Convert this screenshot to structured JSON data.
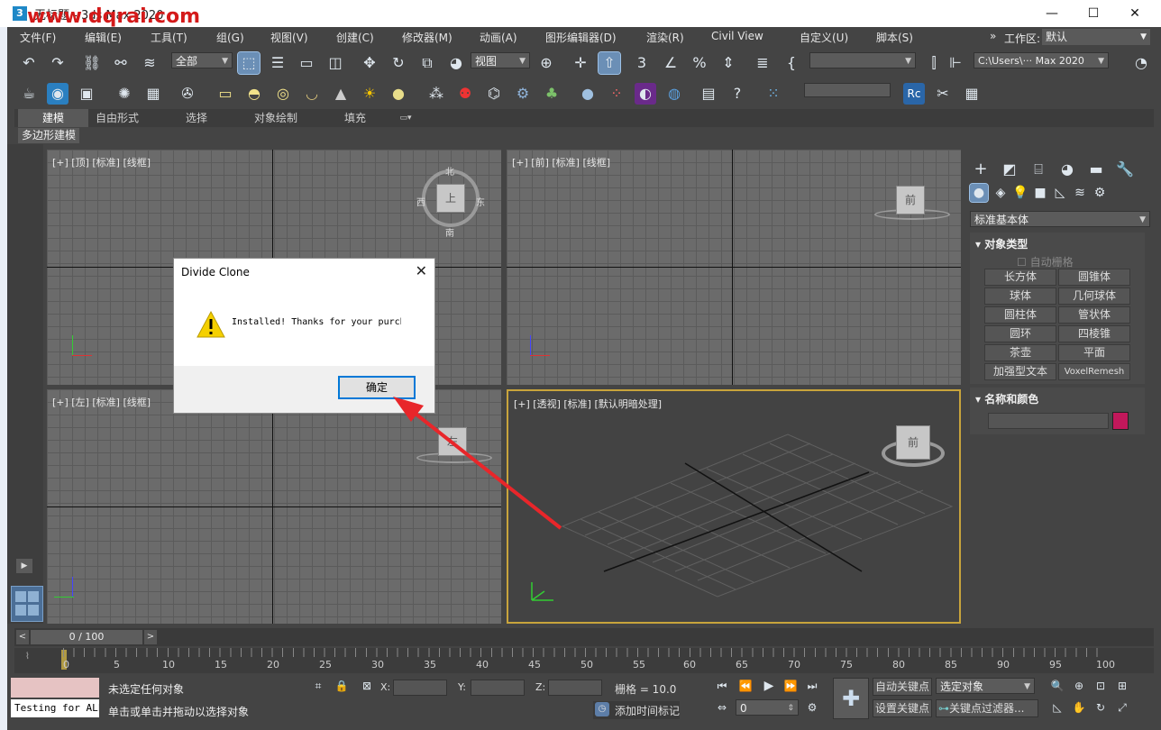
{
  "window": {
    "title": "无标题 - 3ds Max 2020",
    "watermark": "www.dqrai.com",
    "controls": {
      "minimize": "—",
      "maximize": "☐",
      "close": "✕"
    }
  },
  "menubar": {
    "items": [
      "文件(F)",
      "编辑(E)",
      "工具(T)",
      "组(G)",
      "视图(V)",
      "创建(C)",
      "修改器(M)",
      "动画(A)",
      "图形编辑器(D)",
      "渲染(R)",
      "Civil View",
      "自定义(U)",
      "脚本(S)"
    ],
    "workspace_label": "工作区:",
    "workspace_value": "默认",
    "overflow": "»"
  },
  "toolbar": {
    "selection_filter": "全部",
    "ref_coord": "视图",
    "named_sel": "",
    "path": "C:\\Users\\··· Max 2020"
  },
  "ribbon": {
    "tabs": [
      "建模",
      "自由形式",
      "选择",
      "对象绘制",
      "填充"
    ],
    "sub_label": "多边形建模"
  },
  "viewports": {
    "top": {
      "label": "[+] [顶] [标准] [线框]",
      "cube": "上",
      "compass": [
        "北",
        "东",
        "南",
        "西"
      ]
    },
    "front": {
      "label": "[+] [前] [标准] [线框]",
      "cube": "前"
    },
    "left": {
      "label": "[+] [左] [标准] [线框]",
      "cube": "左"
    },
    "persp": {
      "label": "[+] [透视] [标准] [默认明暗处理]",
      "cube": "前"
    }
  },
  "command_panel": {
    "category": "标准基本体",
    "object_type_title": "对象类型",
    "autogrid": "自动栅格",
    "buttons": [
      "长方体",
      "圆锥体",
      "球体",
      "几何球体",
      "圆柱体",
      "管状体",
      "圆环",
      "四棱锥",
      "茶壶",
      "平面",
      "加强型文本",
      "VoxelRemesh"
    ],
    "name_color_title": "名称和颜色",
    "color": "#c2185b"
  },
  "dialog": {
    "title": "Divide Clone",
    "message": "Installed! Thanks for your purchase!",
    "ok": "确定"
  },
  "timeline": {
    "frame": "0 / 100",
    "ticks": [
      "0",
      "5",
      "10",
      "15",
      "20",
      "25",
      "30",
      "35",
      "40",
      "45",
      "50",
      "55",
      "60",
      "65",
      "70",
      "75",
      "80",
      "85",
      "90",
      "95",
      "100"
    ]
  },
  "status": {
    "script_listener": "Testing for ALL",
    "selection_status": "未选定任何对象",
    "prompt": "单击或单击并拖动以选择对象",
    "x_label": "X:",
    "y_label": "Y:",
    "z_label": "Z:",
    "grid": "栅格 = 10.0",
    "add_time_tag": "添加时间标记",
    "auto_key": "自动关键点",
    "set_key": "设置关键点",
    "key_mode": "选定对象",
    "key_filters": "关键点过滤器...",
    "frame_input": "0"
  }
}
